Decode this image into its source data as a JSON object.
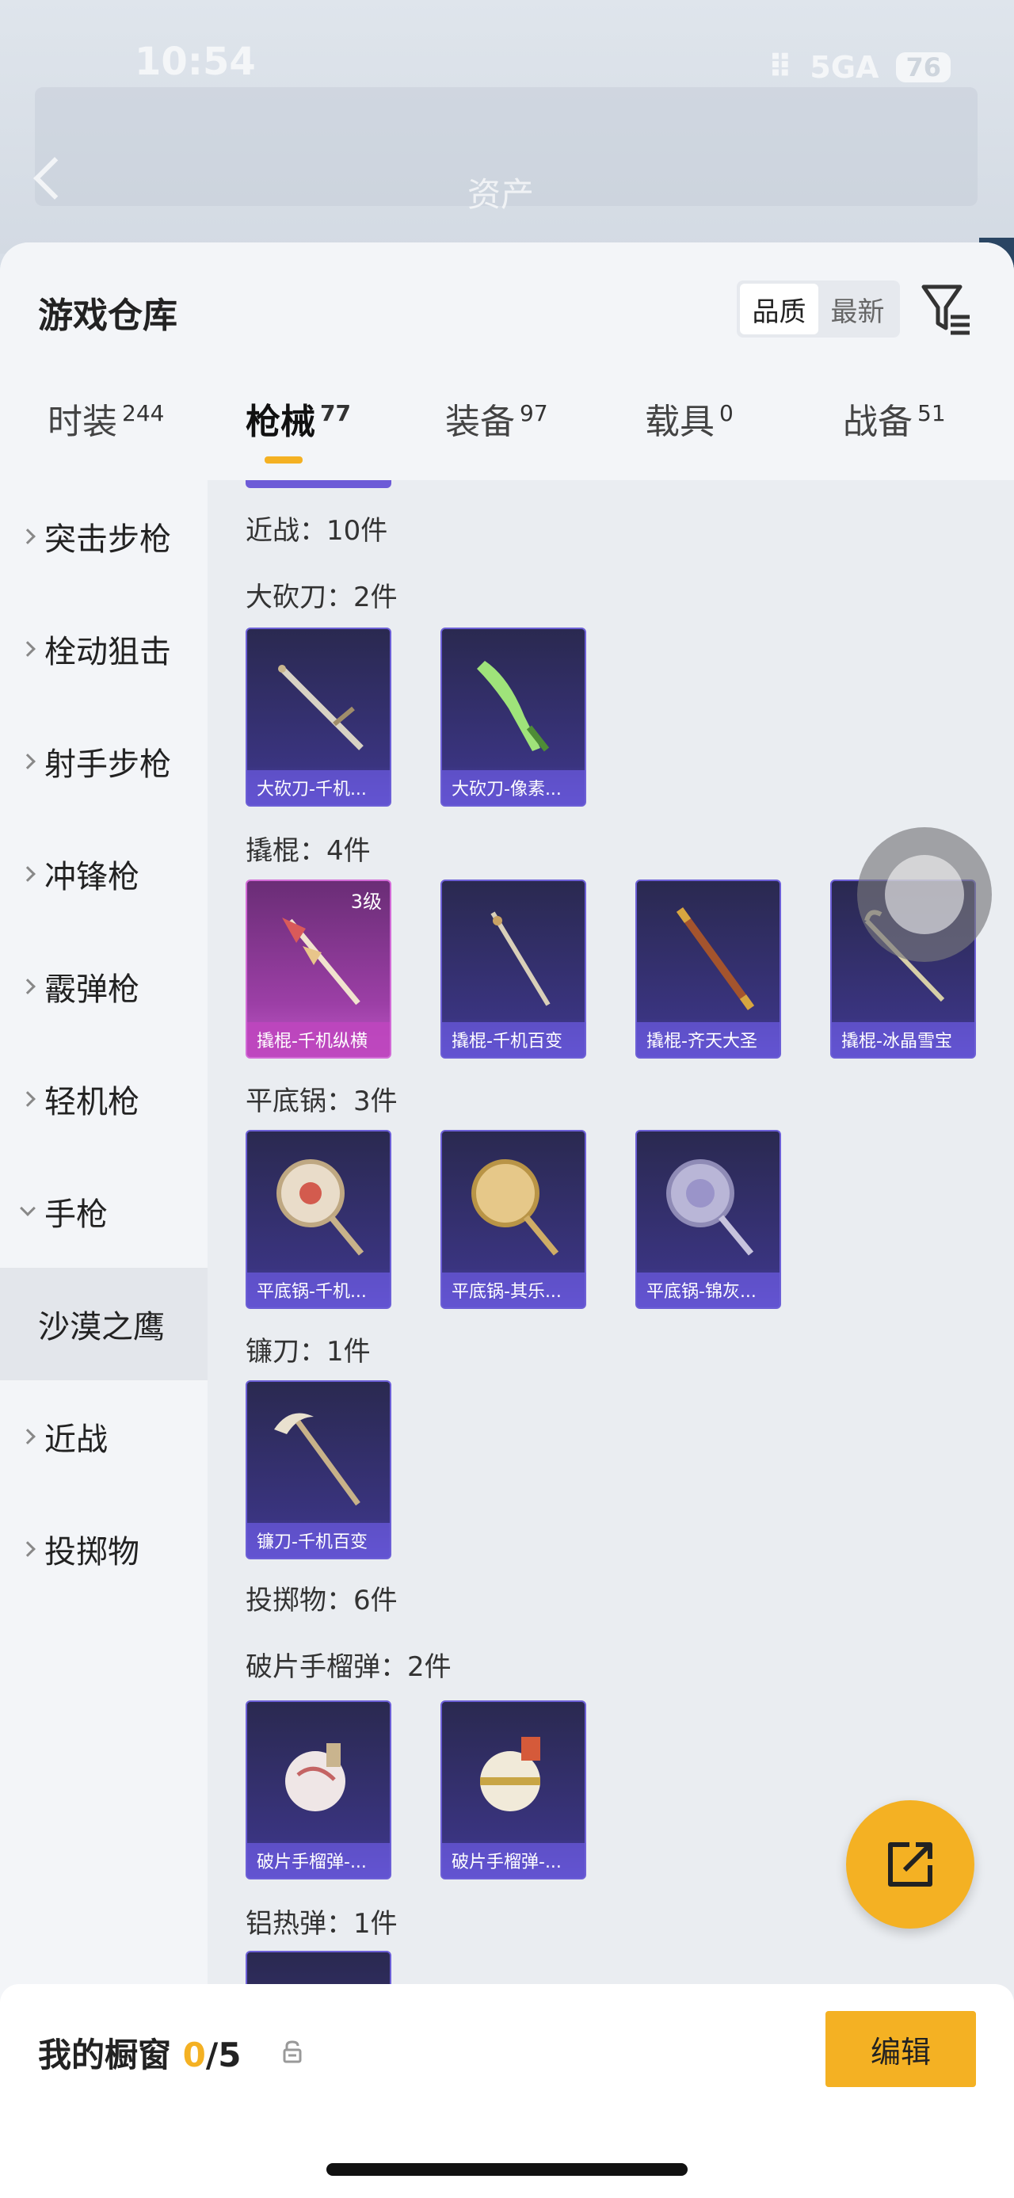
{
  "status": {
    "time": "10:54",
    "network": "5GA",
    "battery": "76"
  },
  "top": {
    "title": "资产"
  },
  "sheet": {
    "title": "游戏仓库",
    "sort": [
      "品质",
      "最新"
    ]
  },
  "tabs": [
    {
      "label": "时装",
      "count": "244"
    },
    {
      "label": "枪械",
      "count": "77"
    },
    {
      "label": "装备",
      "count": "97"
    },
    {
      "label": "载具",
      "count": "0"
    },
    {
      "label": "战备",
      "count": "51"
    }
  ],
  "sidebar": [
    {
      "label": "突击步枪"
    },
    {
      "label": "栓动狙击"
    },
    {
      "label": "射手步枪"
    },
    {
      "label": "冲锋枪"
    },
    {
      "label": "霰弹枪"
    },
    {
      "label": "轻机枪"
    },
    {
      "label": "手枪"
    },
    {
      "label": "沙漠之鹰"
    },
    {
      "label": "近战"
    },
    {
      "label": "投掷物"
    }
  ],
  "content": {
    "sections": [
      {
        "label": "近战：10件"
      },
      {
        "label": "大砍刀：2件"
      },
      {
        "label": "撬棍：4件"
      },
      {
        "label": "平底锅：3件"
      },
      {
        "label": "镰刀：1件"
      },
      {
        "label": "投掷物：6件"
      },
      {
        "label": "破片手榴弹：2件"
      },
      {
        "label": "铝热弹：1件"
      }
    ],
    "cards": [
      {
        "caption": "大砍刀-千机...",
        "level": ""
      },
      {
        "caption": "大砍刀-像素...",
        "level": ""
      },
      {
        "caption": "撬棍-千机纵横",
        "level": "3级"
      },
      {
        "caption": "撬棍-千机百变",
        "level": ""
      },
      {
        "caption": "撬棍-齐天大圣",
        "level": ""
      },
      {
        "caption": "撬棍-冰晶雪宝",
        "level": ""
      },
      {
        "caption": "平底锅-千机...",
        "level": ""
      },
      {
        "caption": "平底锅-其乐...",
        "level": ""
      },
      {
        "caption": "平底锅-锦灰...",
        "level": ""
      },
      {
        "caption": "镰刀-千机百变",
        "level": ""
      },
      {
        "caption": "破片手榴弹-...",
        "level": ""
      },
      {
        "caption": "破片手榴弹-...",
        "level": ""
      }
    ]
  },
  "bottom": {
    "title": "我的橱窗",
    "current": "0",
    "total": "/5",
    "edit_label": "编辑"
  },
  "colors": {
    "accent": "#f4b123",
    "card_purple": "#5c4fc9",
    "card_pink": "#c159c8"
  }
}
